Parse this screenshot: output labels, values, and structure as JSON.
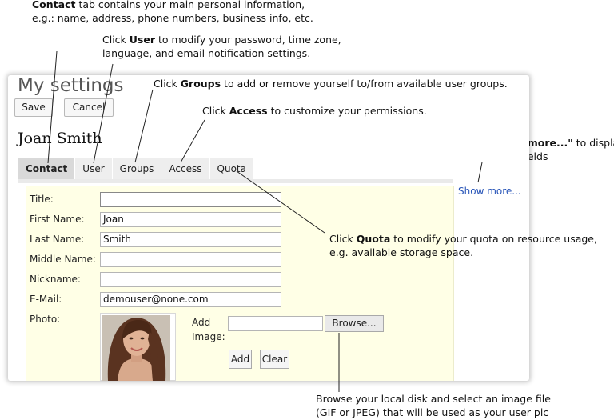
{
  "annotations": {
    "contact": {
      "bold": "Contact",
      "line1_rest": " tab contains your main personal information,",
      "line2": "e.g.: name, address, phone numbers, business info, etc."
    },
    "user": {
      "pre": "Click ",
      "bold": "User",
      "line1_rest": " to modify your password, time zone,",
      "line2": "language, and email notification settings."
    },
    "groups": {
      "pre": "Click ",
      "bold": "Groups",
      "rest": " to add or remove yourself to/from available user groups."
    },
    "access": {
      "pre": "Click ",
      "bold": "Access",
      "rest": " to customize your permissions."
    },
    "show_more": {
      "bold": "Click \"Show more...\"",
      "line1_rest": " to display",
      "line2": "all available fields"
    },
    "quota": {
      "pre": "Click ",
      "bold": "Quota",
      "line1_rest": " to modify your quota on resource usage,",
      "line2": "e.g. available storage space."
    },
    "browse": {
      "line1": "Browse your local disk and select an image file",
      "line2": "(GIF or JPEG) that will be used as your user pic"
    }
  },
  "page": {
    "title": "My settings",
    "save_label": "Save",
    "cancel_label": "Cancel",
    "user_name": "Joan Smith"
  },
  "tabs": [
    {
      "label": "Contact",
      "active": true
    },
    {
      "label": "User",
      "active": false
    },
    {
      "label": "Groups",
      "active": false
    },
    {
      "label": "Access",
      "active": false
    },
    {
      "label": "Quota",
      "active": false
    }
  ],
  "show_more_link": "Show more...",
  "form": {
    "fields": [
      {
        "label": "Title:",
        "value": ""
      },
      {
        "label": "First Name:",
        "value": "Joan"
      },
      {
        "label": "Last Name:",
        "value": "Smith"
      },
      {
        "label": "Middle Name:",
        "value": ""
      },
      {
        "label": "Nickname:",
        "value": ""
      },
      {
        "label": "E-Mail:",
        "value": "demouser@none.com"
      }
    ],
    "photo_label": "Photo:",
    "add_image_label": "Add Image:",
    "browse_label": "Browse...",
    "add_label": "Add",
    "clear_label": "Clear"
  }
}
